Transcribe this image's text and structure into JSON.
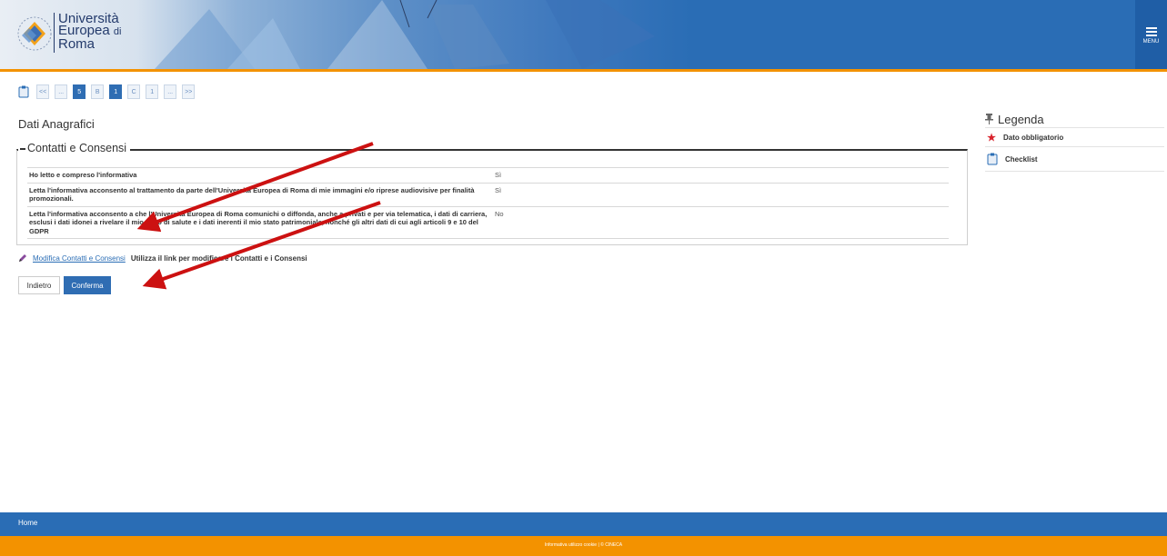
{
  "header": {
    "logo_line1": "Università",
    "logo_line2": "Europea",
    "logo_line2b": "di",
    "logo_line3": "Roma",
    "menu_label": "MENU"
  },
  "steps": [
    "<<",
    "...",
    "5",
    "B",
    "1",
    "C",
    "1",
    "...",
    ">>"
  ],
  "page_title": "Dati Anagrafici",
  "section": {
    "legend": "Contatti e Consensi",
    "rows": [
      {
        "question": "Ho letto e compreso l'informativa",
        "answer": "Sì"
      },
      {
        "question": "Letta l'informativa acconsento al trattamento da parte dell'Università Europea di Roma di mie immagini e/o riprese audiovisive per finalità promozionali.",
        "answer": "Sì"
      },
      {
        "question": "Letta l'informativa acconsento a che l'Università Europea di Roma comunichi o diffonda, anche a privati e per via telematica, i dati di carriera, esclusi i dati idonei a rivelare il mio stato di salute e i dati inerenti il mio stato patrimoniale, nonché gli altri dati di cui agli articoli 9 e 10 del GDPR",
        "answer": "No"
      }
    ]
  },
  "edit": {
    "link": "Modifica Contatti e Consensi",
    "note": "Utilizza il link per modificare i Contatti e i Consensi"
  },
  "buttons": {
    "back": "Indietro",
    "confirm": "Conferma"
  },
  "legend_panel": {
    "title": "Legenda",
    "items": [
      {
        "icon": "star-icon",
        "label": "Dato obbligatorio"
      },
      {
        "icon": "checklist-icon",
        "label": "Checklist"
      }
    ]
  },
  "footer": {
    "home": "Home",
    "info": "Informativa utilizzo cookie | © CINECA"
  },
  "colors": {
    "brand_blue": "#2a6db5",
    "accent_orange": "#f39200",
    "arrow_red": "#cc1111"
  }
}
